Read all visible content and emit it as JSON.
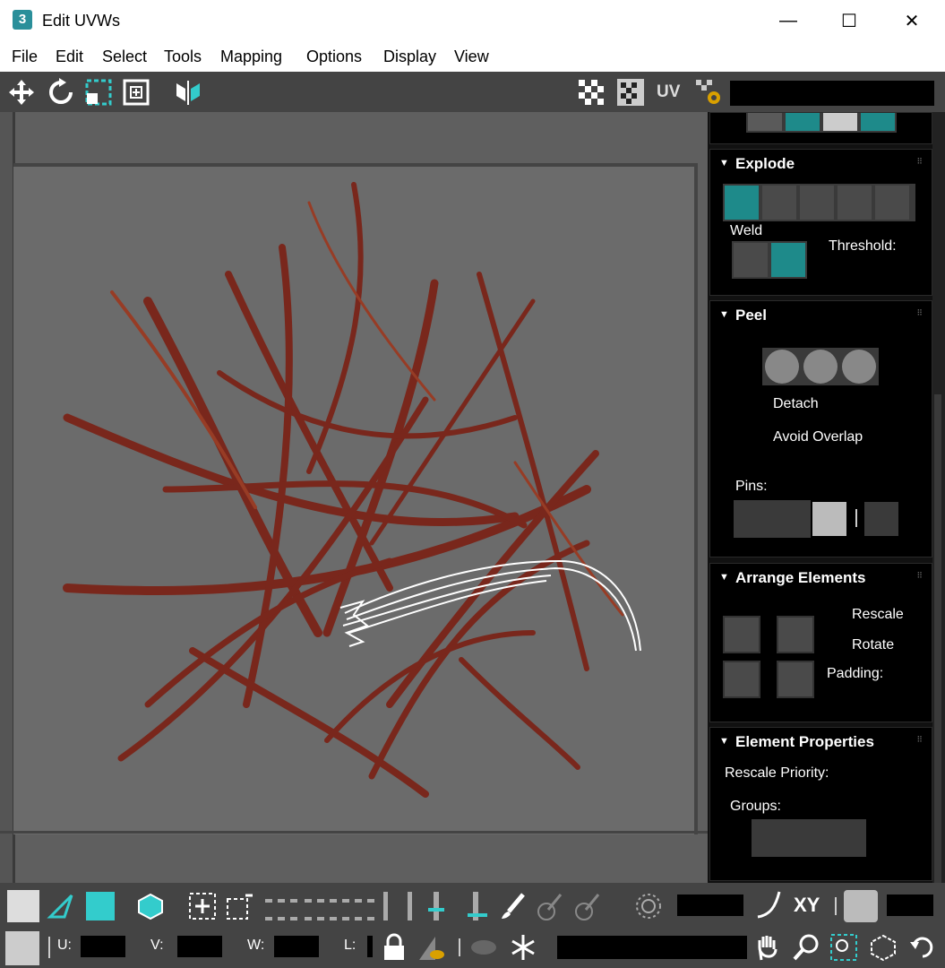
{
  "window": {
    "title": "Edit UVWs",
    "app_icon": "3",
    "minimize": "—",
    "maximize": "☐",
    "close": "✕"
  },
  "menu": [
    "File",
    "Edit",
    "Select",
    "Tools",
    "Mapping",
    "Options",
    "Display",
    "View"
  ],
  "toolbar": {
    "uv_label": "UV"
  },
  "panel": {
    "explode": {
      "title": "Explode",
      "weld_label": "Weld",
      "threshold_label": "Threshold:"
    },
    "peel": {
      "title": "Peel",
      "detach_label": "Detach",
      "avoid_overlap_label": "Avoid Overlap",
      "pins_label": "Pins:"
    },
    "arrange": {
      "title": "Arrange Elements",
      "rescale_label": "Rescale",
      "rotate_label": "Rotate",
      "padding_label": "Padding:"
    },
    "element_props": {
      "title": "Element Properties",
      "rescale_priority_label": "Rescale Priority:",
      "groups_label": "Groups:"
    }
  },
  "bottom": {
    "xy_label": "XY",
    "u_label": "U:",
    "v_label": "V:",
    "w_label": "W:",
    "l_label": "L:"
  },
  "colors": {
    "accent_teal": "#1e8a8a",
    "saffron": "#8b2a1c",
    "uv_mesh": "#ffffff"
  }
}
